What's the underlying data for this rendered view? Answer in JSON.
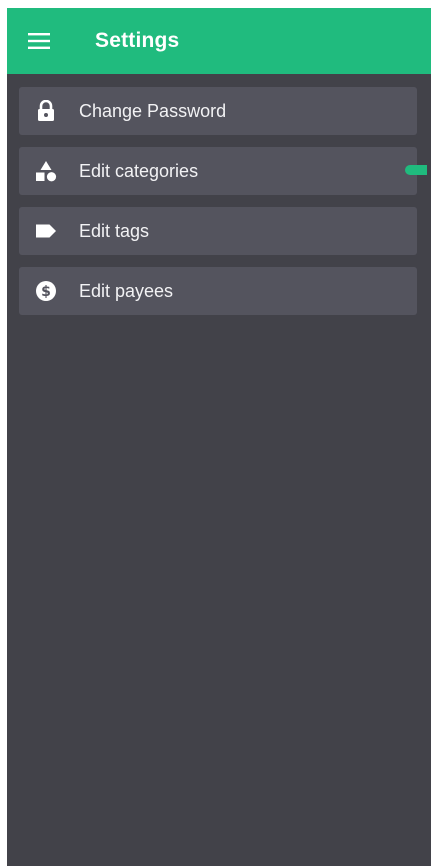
{
  "colors": {
    "app_bar": "#20bb7e",
    "background": "#424249",
    "list_item": "#54545e",
    "text": "#f2f2f4"
  },
  "header": {
    "title": "Settings",
    "menu_icon": "hamburger-menu-icon"
  },
  "settings": {
    "items": [
      {
        "label": "Change Password",
        "icon": "lock-icon"
      },
      {
        "label": "Edit categories",
        "icon": "shapes-icon"
      },
      {
        "label": "Edit tags",
        "icon": "tag-icon"
      },
      {
        "label": "Edit payees",
        "icon": "dollar-circle-icon"
      }
    ]
  }
}
